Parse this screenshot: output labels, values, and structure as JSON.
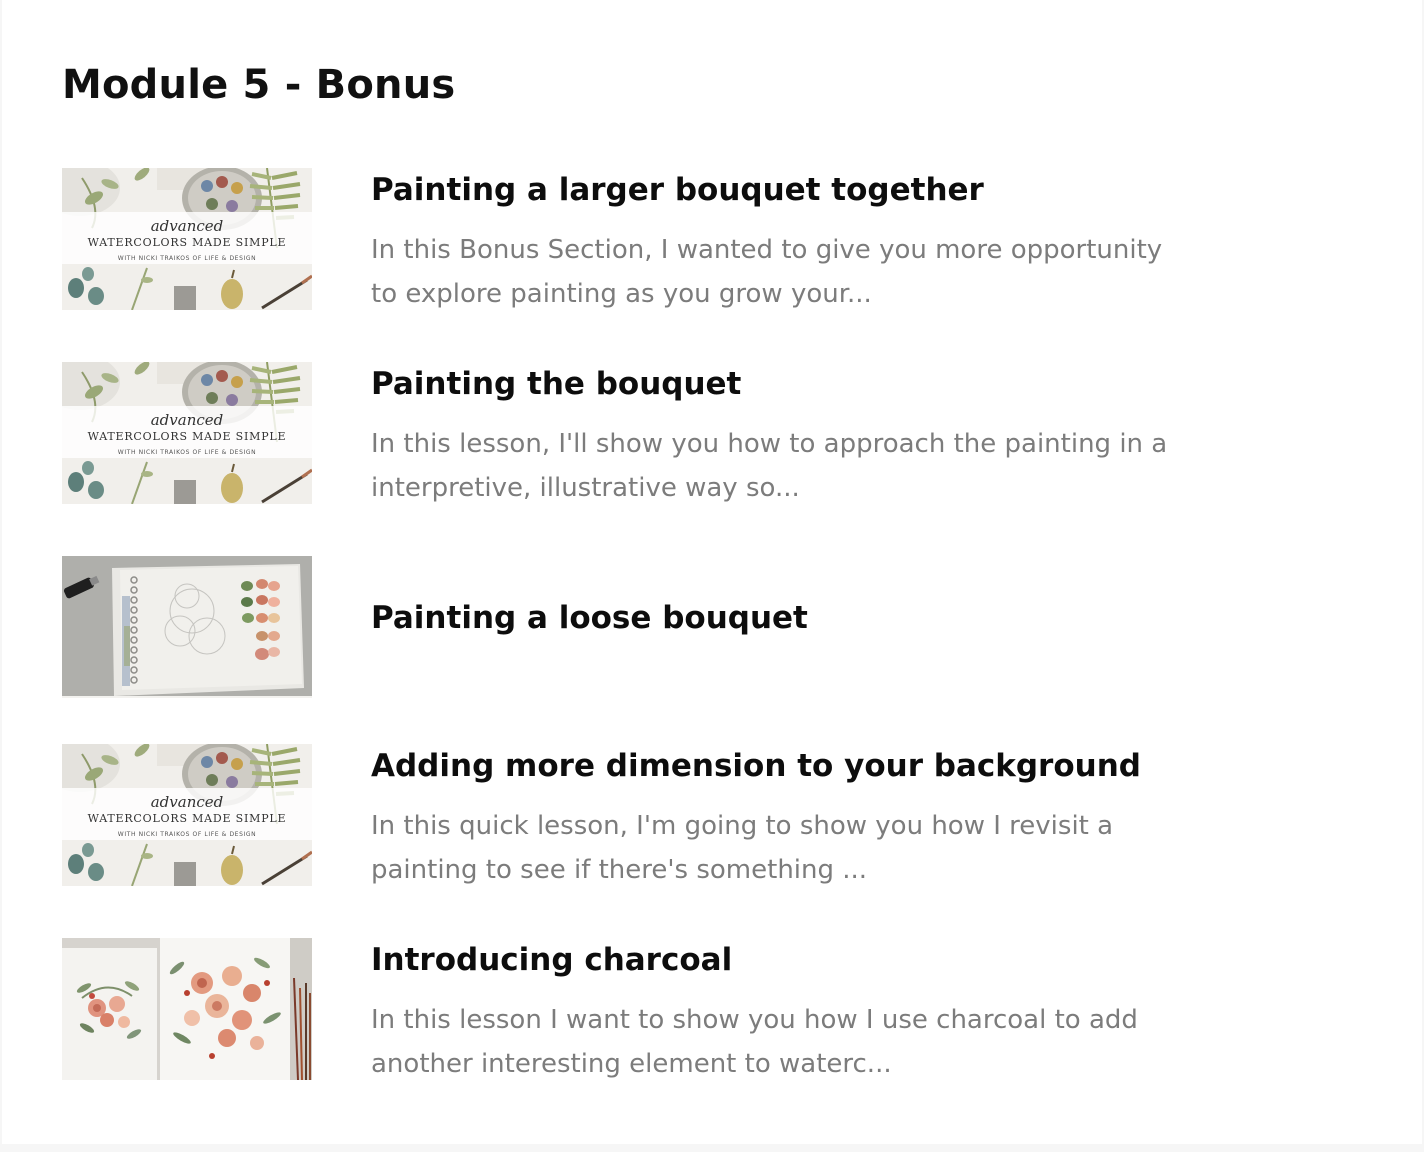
{
  "module": {
    "title": "Module 5 - Bonus"
  },
  "branding": {
    "thumb_script": "advanced",
    "thumb_heading": "WATERCOLORS MADE SIMPLE",
    "thumb_sub": "WITH NICKI TRAIKOS OF LIFE & DESIGN"
  },
  "lessons": [
    {
      "title": "Painting a larger bouquet together",
      "description": "In this Bonus Section, I wanted to give you more opportunity to explore painting as you grow your...",
      "thumbnail": "course-cover-image"
    },
    {
      "title": "Painting the bouquet",
      "description": "In this lesson, I'll show you how to approach the painting in a interpretive, illustrative way so...",
      "thumbnail": "course-cover-image"
    },
    {
      "title": "Painting a loose bouquet",
      "description": "",
      "thumbnail": "sketchbook-swatches-image"
    },
    {
      "title": "Adding more dimension to your background",
      "description": "In this quick lesson, I'm going to show you how I revisit a painting to see if there's something ...",
      "thumbnail": "course-cover-image"
    },
    {
      "title": "Introducing charcoal",
      "description": "In this lesson I want to show you how I use charcoal to add another interesting element to waterc...",
      "thumbnail": "floral-paintings-image"
    }
  ],
  "colors": {
    "title": "#0d0d0d",
    "description": "#7c7c7c",
    "page_background": "#f6f6f6",
    "card_background": "#ffffff"
  }
}
